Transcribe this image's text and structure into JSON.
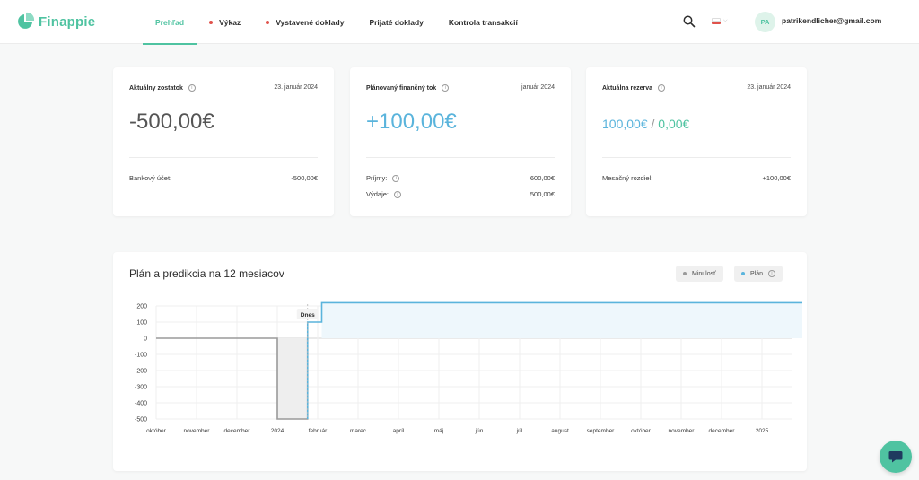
{
  "app": {
    "name": "Finappie"
  },
  "nav": {
    "items": [
      {
        "label": "Prehľad",
        "active": true,
        "dot": false
      },
      {
        "label": "Výkaz",
        "active": false,
        "dot": true
      },
      {
        "label": "Vystavené doklady",
        "active": false,
        "dot": true
      },
      {
        "label": "Prijaté doklady",
        "active": false,
        "dot": false
      },
      {
        "label": "Kontrola transakcií",
        "active": false,
        "dot": false
      }
    ]
  },
  "header": {
    "language_flag": "slovak-flag-icon",
    "avatar_initials": "PA",
    "user_email": "patrikendlicher@gmail.com"
  },
  "cards": {
    "balance": {
      "title": "Aktuálny zostatok",
      "date": "23. január 2024",
      "amount": "-500,00€",
      "rows": [
        {
          "label": "Bankový účet:",
          "value": "-500,00€"
        }
      ]
    },
    "cashflow": {
      "title": "Plánovaný finančný tok",
      "date": "január 2024",
      "amount": "+100,00€",
      "rows": [
        {
          "label": "Príjmy:",
          "value": "600,00€"
        },
        {
          "label": "Výdaje:",
          "value": "500,00€"
        }
      ]
    },
    "reserve": {
      "title": "Aktuálna rezerva",
      "date": "23. január 2024",
      "amount_planned": "100,00€",
      "amount_separator": "/",
      "amount_actual": "0,00€",
      "rows": [
        {
          "label": "Mesačný rozdiel:",
          "value": "+100,00€"
        }
      ]
    }
  },
  "chart_section": {
    "title": "Plán a predikcia na 12 mesiacov",
    "legend": [
      {
        "label": "Minulosť",
        "color": "#9a9a9a"
      },
      {
        "label": "Plán",
        "color": "#5ab4dc"
      }
    ]
  },
  "chart_data": {
    "type": "line",
    "today_label": "Dnes",
    "ylim": [
      -500,
      200
    ],
    "y_ticks": [
      200,
      100,
      0,
      -100,
      -200,
      -300,
      -400,
      -500
    ],
    "x_ticks": [
      "október",
      "november",
      "december",
      "2024",
      "február",
      "marec",
      "apríl",
      "máj",
      "jún",
      "júl",
      "august",
      "september",
      "október",
      "november",
      "december",
      "2025"
    ],
    "series": [
      {
        "name": "Minulosť",
        "color": "#9a9a9a",
        "points": [
          [
            0,
            0
          ],
          [
            3,
            0
          ],
          [
            3,
            -500
          ],
          [
            3.75,
            -500
          ],
          [
            3.75,
            0
          ]
        ]
      },
      {
        "name": "Plán",
        "color": "#5ab4dc",
        "points": [
          [
            3.75,
            -500
          ],
          [
            3.75,
            100
          ],
          [
            4.1,
            100
          ],
          [
            4.1,
            220
          ],
          [
            16,
            220
          ]
        ]
      }
    ]
  },
  "colors": {
    "brand": "#4fc3a1",
    "plan_blue": "#5ab4dc",
    "reserve_green": "#4fc3a1",
    "nav_dot_red": "#e0524b"
  }
}
